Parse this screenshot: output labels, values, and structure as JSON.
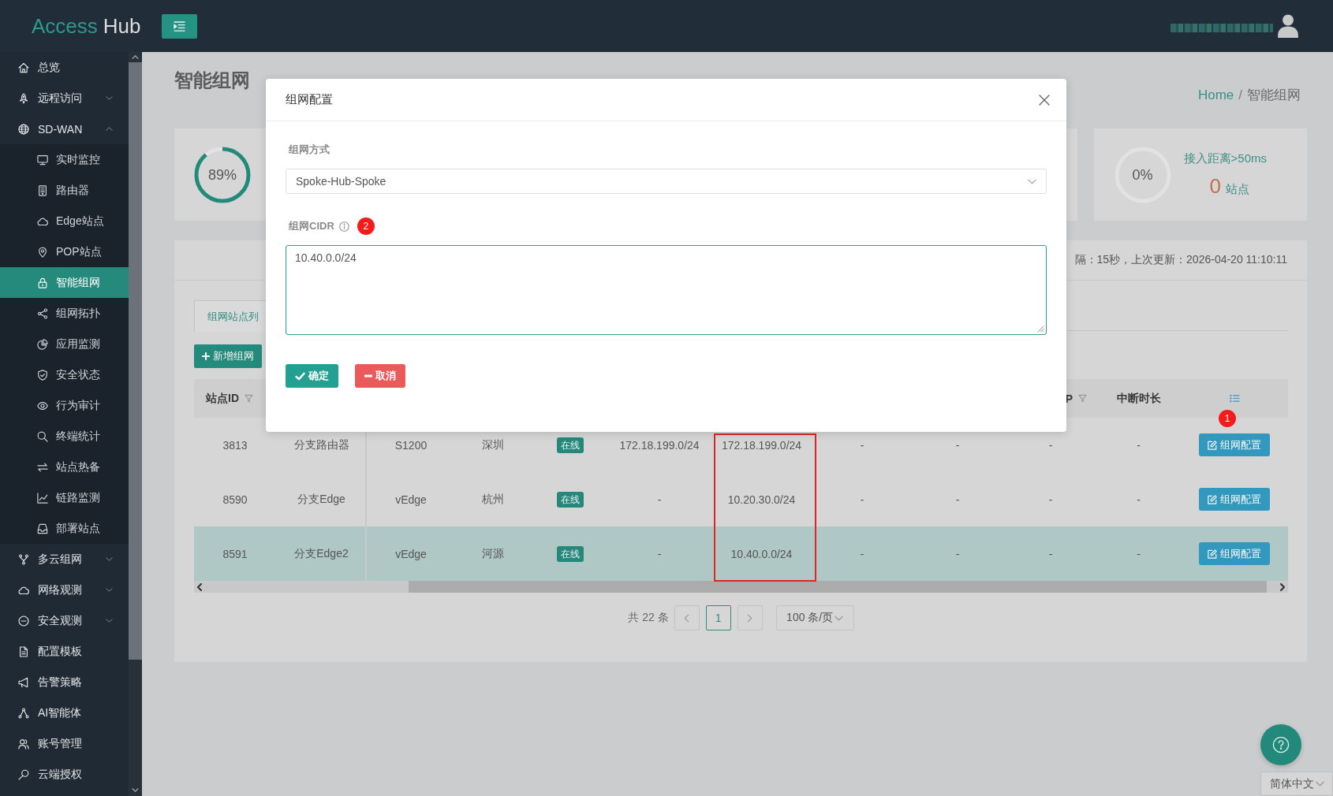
{
  "header": {
    "logo": [
      {
        "text": "Access",
        "accent": true
      },
      {
        "text": "Hub",
        "accent": false
      }
    ]
  },
  "sidebar": {
    "items": [
      {
        "label": "总览",
        "selected": false
      },
      {
        "label": "远程访问",
        "selected": false,
        "expanded": false
      },
      {
        "label": "SD-WAN",
        "selected": false,
        "expanded": true,
        "children": [
          {
            "label": "实时监控",
            "selected": false
          },
          {
            "label": "路由器",
            "selected": false
          },
          {
            "label": "Edge站点",
            "selected": false
          },
          {
            "label": "POP站点",
            "selected": false
          },
          {
            "label": "智能组网",
            "selected": true
          },
          {
            "label": "组网拓扑",
            "selected": false
          },
          {
            "label": "应用监测",
            "selected": false
          },
          {
            "label": "安全状态",
            "selected": false
          },
          {
            "label": "行为审计",
            "selected": false
          },
          {
            "label": "终端统计",
            "selected": false
          },
          {
            "label": "站点热备",
            "selected": false
          },
          {
            "label": "链路监测",
            "selected": false
          },
          {
            "label": "部署站点",
            "selected": false
          }
        ]
      },
      {
        "label": "多云组网",
        "selected": false,
        "expanded": false
      },
      {
        "label": "网络观测",
        "selected": false,
        "expanded": false
      },
      {
        "label": "安全观测",
        "selected": false,
        "expanded": false
      },
      {
        "label": "配置模板",
        "selected": false
      },
      {
        "label": "告警策略",
        "selected": false
      },
      {
        "label": "AI智能体",
        "selected": false
      },
      {
        "label": "账号管理",
        "selected": false
      },
      {
        "label": "云端授权",
        "selected": false
      }
    ]
  },
  "page": {
    "title": "智能组网",
    "breadcrumb": [
      {
        "label": "Home",
        "kind": "link"
      },
      {
        "label": "/",
        "kind": "separator"
      },
      {
        "label": "智能组网",
        "kind": "current"
      }
    ]
  },
  "stat_cards": [
    {
      "reading": "89%",
      "level": 0.89
    },
    {
      "reading": "0%",
      "level": 0,
      "title": "接入距离>50ms",
      "count": "0",
      "unit": "站点"
    }
  ],
  "status_panel": {
    "text": "隔：15秒，上次更新：2026-04-20 11:10:11"
  },
  "tabs": [
    {
      "label": "组网站点列",
      "selected": true
    }
  ],
  "add_button": {
    "label": "新增组网"
  },
  "table": {
    "header_cells": [
      {
        "kind": "text",
        "label": "站点ID",
        "filter": true
      },
      {
        "kind": "text",
        "label": "P",
        "filter": true
      },
      {
        "kind": "text",
        "label": "中断时长",
        "filter": false
      },
      {
        "kind": "settings",
        "marker": "1"
      }
    ],
    "rows": [
      {
        "selected": false,
        "cells": [
          {
            "kind": "text",
            "text": "3813"
          },
          {
            "kind": "text",
            "text": "分支路由器"
          },
          {
            "kind": "text",
            "text": "S1200"
          },
          {
            "kind": "text",
            "text": "深圳"
          },
          {
            "kind": "tag",
            "text": "在线"
          },
          {
            "kind": "text",
            "text": "172.18.199.0/24"
          },
          {
            "kind": "text",
            "text": "172.18.199.0/24"
          },
          {
            "kind": "text",
            "text": "-"
          },
          {
            "kind": "text",
            "text": "-"
          },
          {
            "kind": "text",
            "text": "-"
          },
          {
            "kind": "text",
            "text": "-"
          },
          {
            "kind": "button",
            "text": "组网配置"
          }
        ]
      },
      {
        "selected": false,
        "cells": [
          {
            "kind": "text",
            "text": "8590"
          },
          {
            "kind": "text",
            "text": "分支Edge"
          },
          {
            "kind": "text",
            "text": "vEdge"
          },
          {
            "kind": "text",
            "text": "杭州"
          },
          {
            "kind": "tag",
            "text": "在线"
          },
          {
            "kind": "text",
            "text": "-"
          },
          {
            "kind": "text",
            "text": "10.20.30.0/24"
          },
          {
            "kind": "text",
            "text": "-"
          },
          {
            "kind": "text",
            "text": "-"
          },
          {
            "kind": "text",
            "text": "-"
          },
          {
            "kind": "text",
            "text": "-"
          },
          {
            "kind": "button",
            "text": "组网配置"
          }
        ]
      },
      {
        "selected": true,
        "cells": [
          {
            "kind": "text",
            "text": "8591"
          },
          {
            "kind": "text",
            "text": "分支Edge2"
          },
          {
            "kind": "text",
            "text": "vEdge"
          },
          {
            "kind": "text",
            "text": "河源"
          },
          {
            "kind": "tag",
            "text": "在线"
          },
          {
            "kind": "text",
            "text": "-"
          },
          {
            "kind": "text",
            "text": "10.40.0.0/24"
          },
          {
            "kind": "text",
            "text": "-"
          },
          {
            "kind": "text",
            "text": "-"
          },
          {
            "kind": "text",
            "text": "-"
          },
          {
            "kind": "text",
            "text": "-"
          },
          {
            "kind": "button",
            "text": "组网配置"
          }
        ]
      }
    ],
    "column_7_frame": true
  },
  "pagination": {
    "total": "共 22 条",
    "pages": [
      {
        "label": "1",
        "selected": true
      }
    ],
    "page_size": "100 条/页"
  },
  "modal": {
    "title": "组网配置",
    "fields": [
      {
        "kind": "select",
        "label": "组网方式",
        "value": "Spoke-Hub-Spoke"
      },
      {
        "kind": "textarea",
        "label": "组网CIDR",
        "info": true,
        "marker": "2",
        "value": "10.40.0.0/24",
        "focused": true
      }
    ],
    "buttons": [
      {
        "kind": "confirm",
        "label": "确定"
      },
      {
        "kind": "cancel",
        "label": "取消"
      }
    ]
  },
  "language": "简体中文"
}
